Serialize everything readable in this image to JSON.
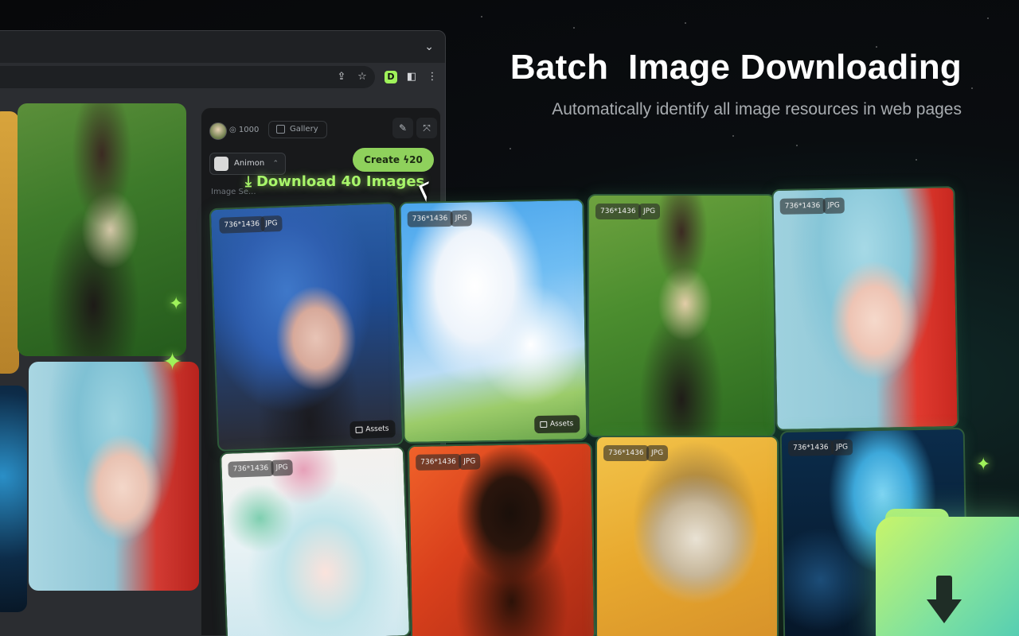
{
  "headline": "Batch  Image Downloading",
  "subheadline": "Automatically identify all image resources in web pages",
  "panel": {
    "credits": "1000",
    "gallery_label": "Gallery",
    "model_name": "Animon",
    "create_label": "Create",
    "create_cost": "20",
    "image_selection_label": "Image Se..."
  },
  "download_label": "Download 40 Images",
  "cards": [
    {
      "size": "736*1436",
      "format": "JPG",
      "assets": "Assets"
    },
    {
      "size": "736*1436",
      "format": "JPG",
      "assets": "Assets"
    },
    {
      "size": "736*1436",
      "format": "JPG"
    },
    {
      "size": "736*1436",
      "format": "JPG"
    },
    {
      "size": "736*1436",
      "format": "JPG"
    },
    {
      "size": "736*1436",
      "format": "JPG"
    },
    {
      "size": "736*1436",
      "format": "JPG"
    },
    {
      "size": "736*1436",
      "format": "JPG"
    }
  ],
  "colors": {
    "accent": "#9ff25a",
    "create_button": "#8fd15c",
    "panel_bg": "#18191b"
  },
  "icons": {
    "tab_chevron": "chevron-down-icon",
    "share": "share-icon",
    "bookmark": "star-icon",
    "extension": "extension-logo-icon",
    "sidepanel": "sidepanel-icon",
    "menu": "more-vertical-icon",
    "download": "download-icon",
    "folder": "folder-icon"
  }
}
